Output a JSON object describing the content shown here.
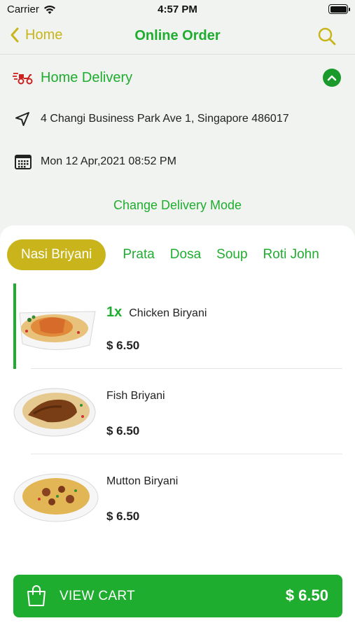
{
  "status": {
    "carrier": "Carrier",
    "time": "4:57 PM"
  },
  "nav": {
    "back_label": "Home",
    "title": "Online Order",
    "icons": {
      "back": "chevron-left-icon",
      "search": "search-icon"
    }
  },
  "delivery": {
    "mode_label": "Home Delivery",
    "address": "4 Changi Business Park Ave 1, Singapore 486017",
    "datetime": "Mon 12 Apr,2021 08:52 PM",
    "change_mode_label": "Change Delivery Mode",
    "icons": {
      "mode": "delivery-scooter-icon",
      "address": "location-arrow-icon",
      "date": "calendar-icon",
      "collapse": "chevron-up-icon"
    }
  },
  "categories": [
    {
      "label": "Nasi Briyani",
      "active": true
    },
    {
      "label": "Prata",
      "active": false
    },
    {
      "label": "Dosa",
      "active": false
    },
    {
      "label": "Soup",
      "active": false
    },
    {
      "label": "Roti John",
      "active": false
    }
  ],
  "items": [
    {
      "name": "Chicken Biryani",
      "qty": "1x",
      "price": "$ 6.50",
      "image": "chicken-biryani-plate"
    },
    {
      "name": "Fish Briyani",
      "qty": "",
      "price": "$ 6.50",
      "image": "fish-biryani-plate"
    },
    {
      "name": "Mutton Biryani",
      "qty": "",
      "price": "$ 6.50",
      "image": "mutton-biryani-plate"
    }
  ],
  "cart": {
    "label": "VIEW CART",
    "total": "$ 6.50",
    "icon": "shopping-bag-icon"
  },
  "colors": {
    "brand_green": "#1fad2f",
    "accent_gold": "#c9b51b",
    "background": "#f1f3f0"
  }
}
